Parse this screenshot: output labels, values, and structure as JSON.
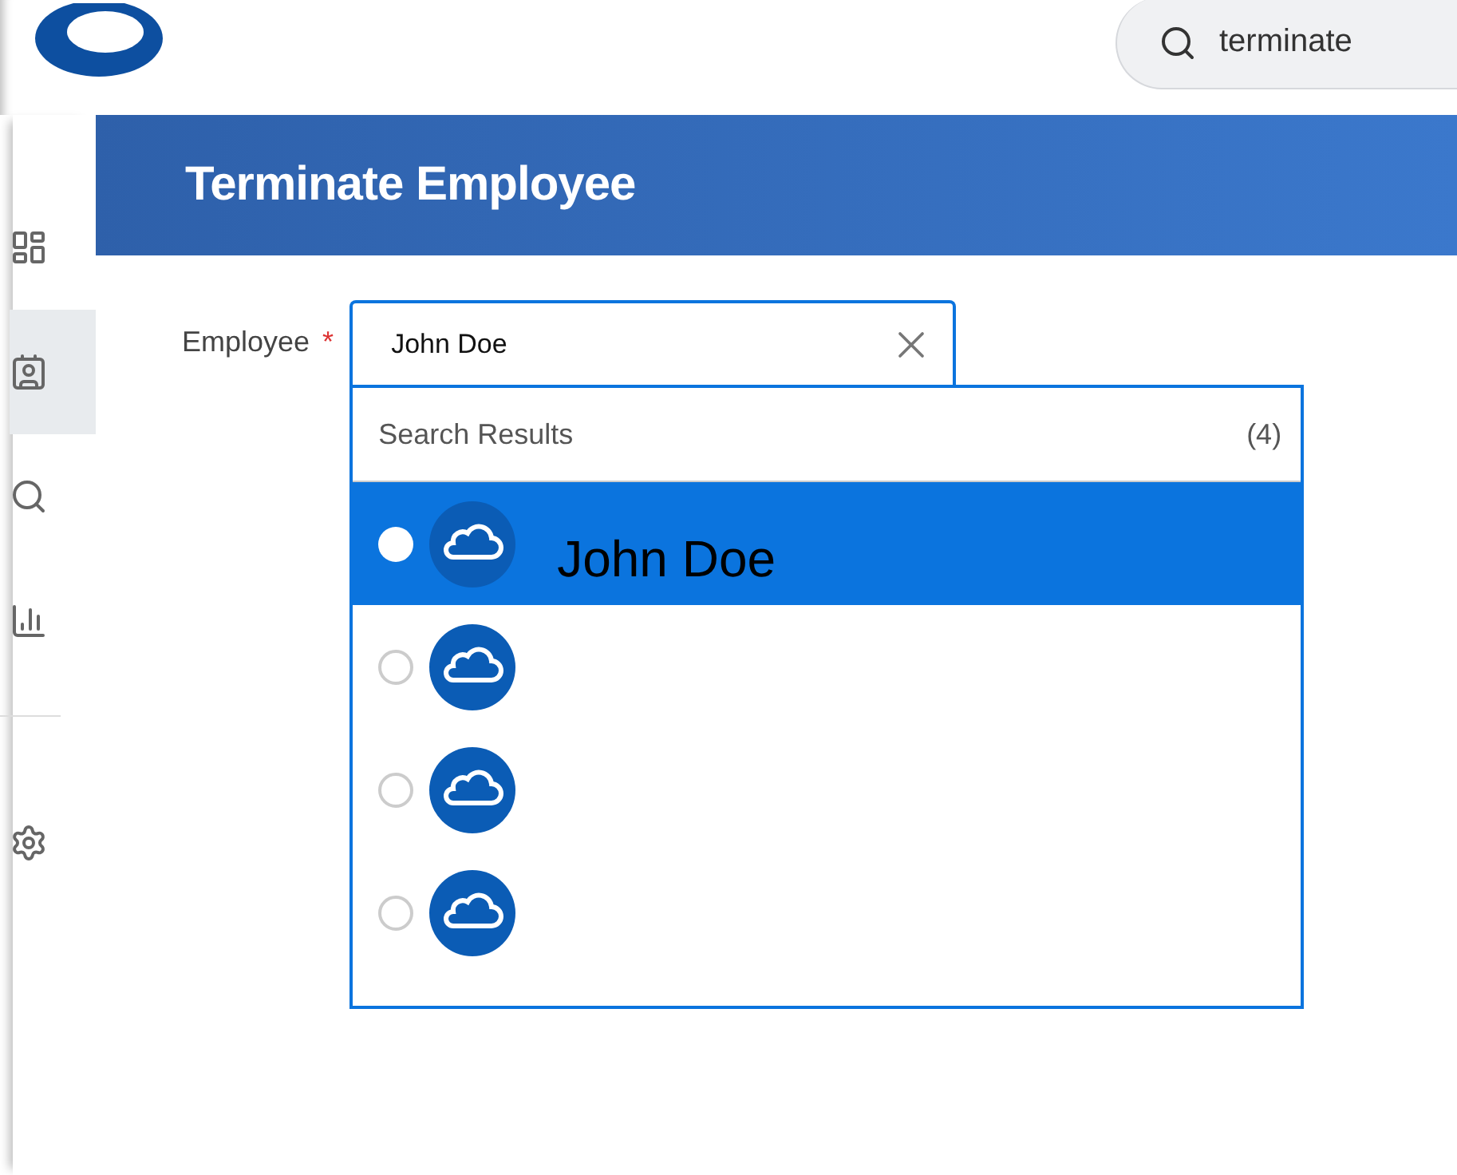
{
  "top_search": {
    "value": "terminate"
  },
  "sidebar": {
    "items": [
      {
        "kind": "dashboard",
        "selected": false
      },
      {
        "kind": "profile",
        "selected": true
      },
      {
        "kind": "person_search",
        "selected": false
      },
      {
        "kind": "chart",
        "selected": false
      },
      {
        "kind": "settings",
        "selected": false
      }
    ]
  },
  "page_title": "Terminate Employee",
  "field": {
    "label": "Employee",
    "required": true,
    "required_mark": "*",
    "value": "John Doe"
  },
  "results": {
    "title": "Search Results",
    "count": "(4)",
    "items": [
      {
        "name": "John Doe",
        "selected": true
      },
      {
        "selected": false
      },
      {
        "selected": false
      },
      {
        "selected": false
      }
    ]
  }
}
